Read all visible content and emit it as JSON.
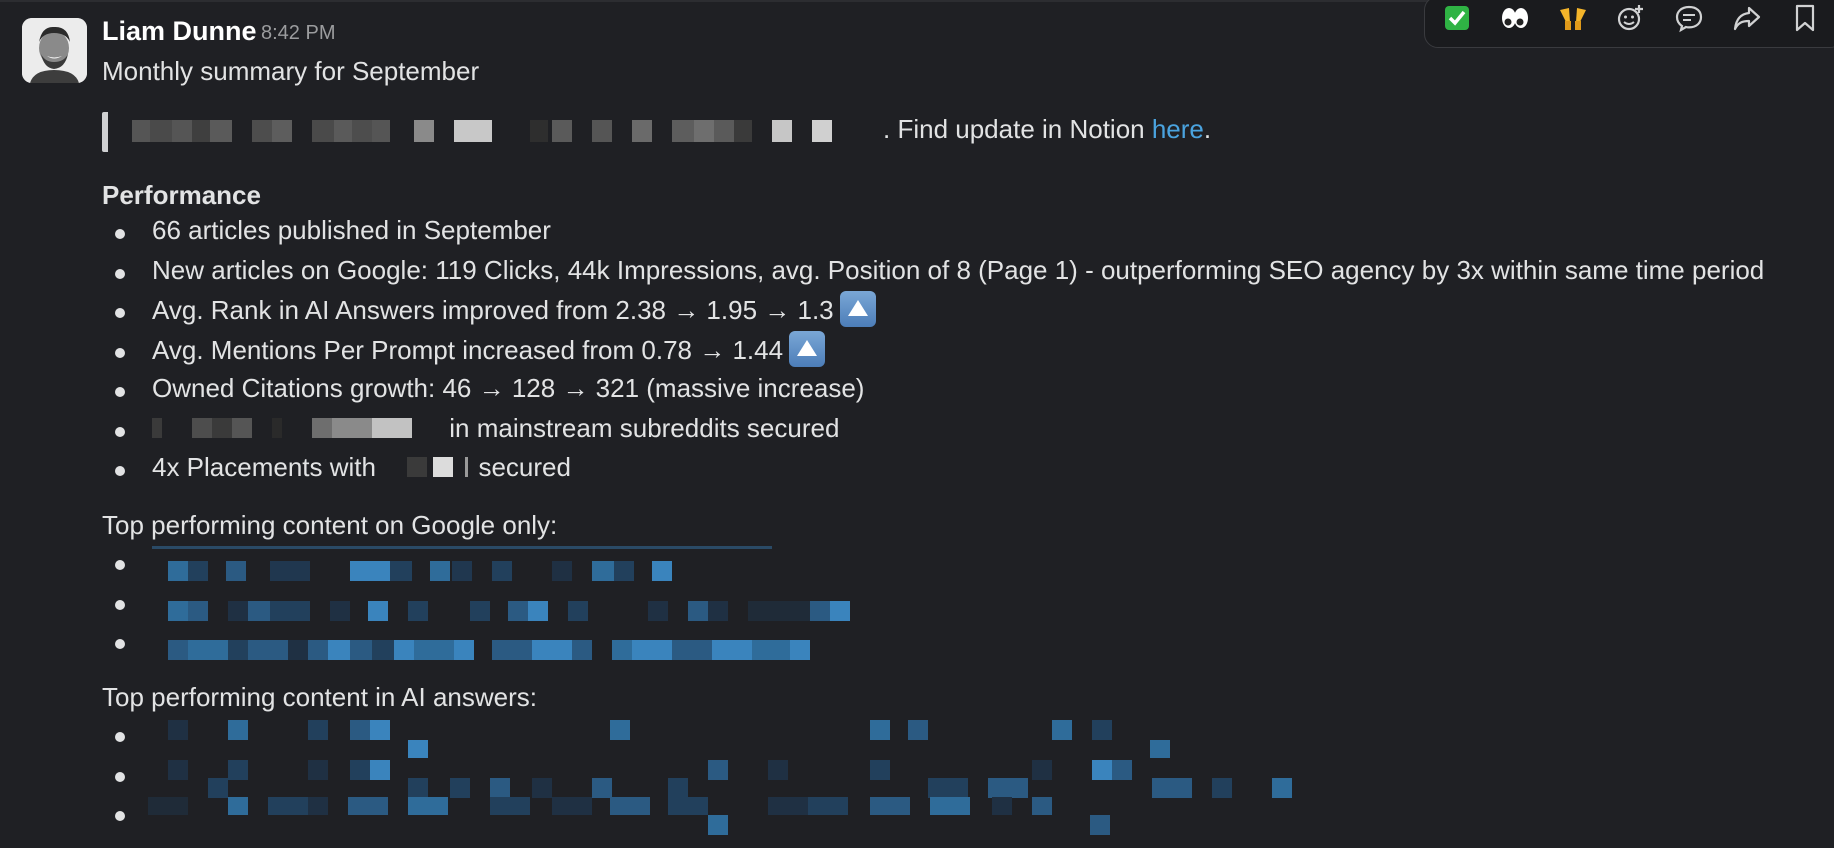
{
  "message": {
    "author": "Liam Dunne",
    "time": "8:42 PM",
    "subtitle": "Monthly summary for September",
    "quote": {
      "suffix": ". Find update in Notion ",
      "link": "here",
      "end": "."
    },
    "performance": {
      "heading": "Performance",
      "items": [
        {
          "text": "66 articles published in September"
        },
        {
          "text": "New articles on Google: 119 Clicks, 44k Impressions, avg. Position of 8 (Page 1) - outperforming SEO agency by 3x within same time period"
        },
        {
          "text": "Avg. Rank in AI Answers improved from 2.38 → 1.95 → 1.3",
          "icon": "up-arrow-icon"
        },
        {
          "text": "Avg. Mentions Per Prompt increased from 0.78 → 1.44",
          "icon": "up-arrow-icon"
        },
        {
          "text": "Owned Citations growth: 46 → 128 → 321 (massive increase)"
        },
        {
          "text": "in mainstream subreddits secured"
        },
        {
          "text_before": "4x Placements with",
          "text_after": "secured"
        }
      ]
    },
    "google_heading": "Top performing content on Google only:",
    "ai_heading": "Top performing content in AI answers:"
  },
  "toolbar": {
    "icons": [
      "check-mark-icon",
      "eyes-icon",
      "raised-hands-icon",
      "add-reaction-icon",
      "reply-thread-icon",
      "forward-icon",
      "bookmark-icon"
    ]
  },
  "colors": {
    "background": "#1f2024",
    "text": "#e2e3e4",
    "link": "#4aa3df",
    "check": "#2fb344"
  }
}
